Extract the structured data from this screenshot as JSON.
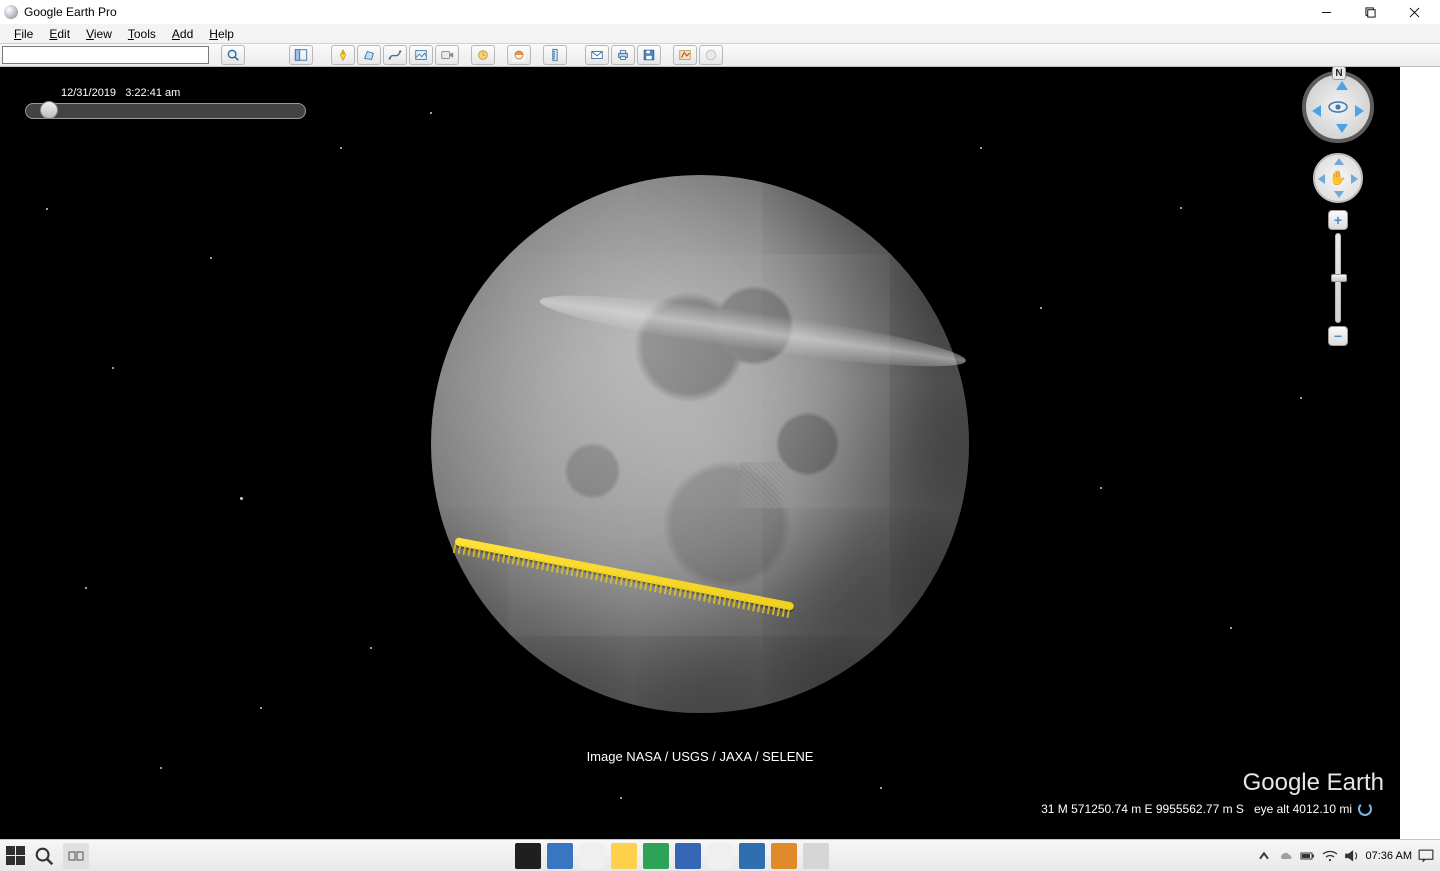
{
  "titlebar": {
    "app_name": "Google Earth Pro"
  },
  "menubar": {
    "items": [
      {
        "ul": "F",
        "rest": "ile"
      },
      {
        "ul": "E",
        "rest": "dit"
      },
      {
        "ul": "V",
        "rest": "iew"
      },
      {
        "ul": "T",
        "rest": "ools"
      },
      {
        "ul": "A",
        "rest": "dd"
      },
      {
        "ul": "H",
        "rest": "elp"
      }
    ]
  },
  "toolbar": {
    "search_value": ""
  },
  "viewport": {
    "timeslider": {
      "date": "12/31/2019",
      "time": "3:22:41 am"
    },
    "credit": "Image NASA / USGS / JAXA / SELENE",
    "watermark_a": "Google",
    "watermark_b": " Earth",
    "status_coords": "31 M 571250.74 m E 9955562.77 m S",
    "status_alt": "eye alt 4012.10 mi"
  },
  "nav": {
    "north_label": "N",
    "zoom_in": "+",
    "zoom_out": "−"
  },
  "taskbar": {
    "clock": "07:36 AM"
  }
}
